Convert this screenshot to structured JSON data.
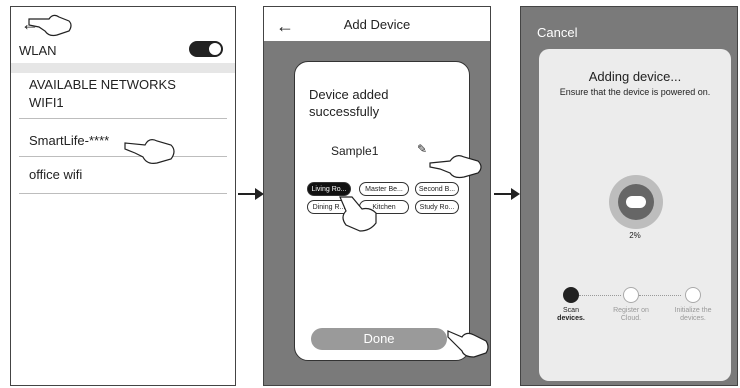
{
  "screen1": {
    "wlan_label": "WLAN",
    "section_heading": "AVAILABLE NETWORKS",
    "networks": [
      "WIFI1",
      "SmartLife-****",
      "office wifi"
    ]
  },
  "screen2": {
    "title": "Add Device",
    "message_line1": "Device added",
    "message_line2": "successfully",
    "device_name": "Sample1",
    "rooms": [
      "Living Ro...",
      "Master Be...",
      "Second B...",
      "Dining R...",
      "Kitchen",
      "Study Ro..."
    ],
    "selected_room": "Living Ro...",
    "done_label": "Done"
  },
  "screen3": {
    "cancel_label": "Cancel",
    "heading": "Adding device...",
    "subheading": "Ensure that the device is powered on.",
    "progress_percent": "2%",
    "steps": [
      {
        "line1": "Scan",
        "line2": "devices."
      },
      {
        "line1": "Register on",
        "line2": "Cloud."
      },
      {
        "line1": "Initialize the",
        "line2": "devices."
      }
    ]
  }
}
